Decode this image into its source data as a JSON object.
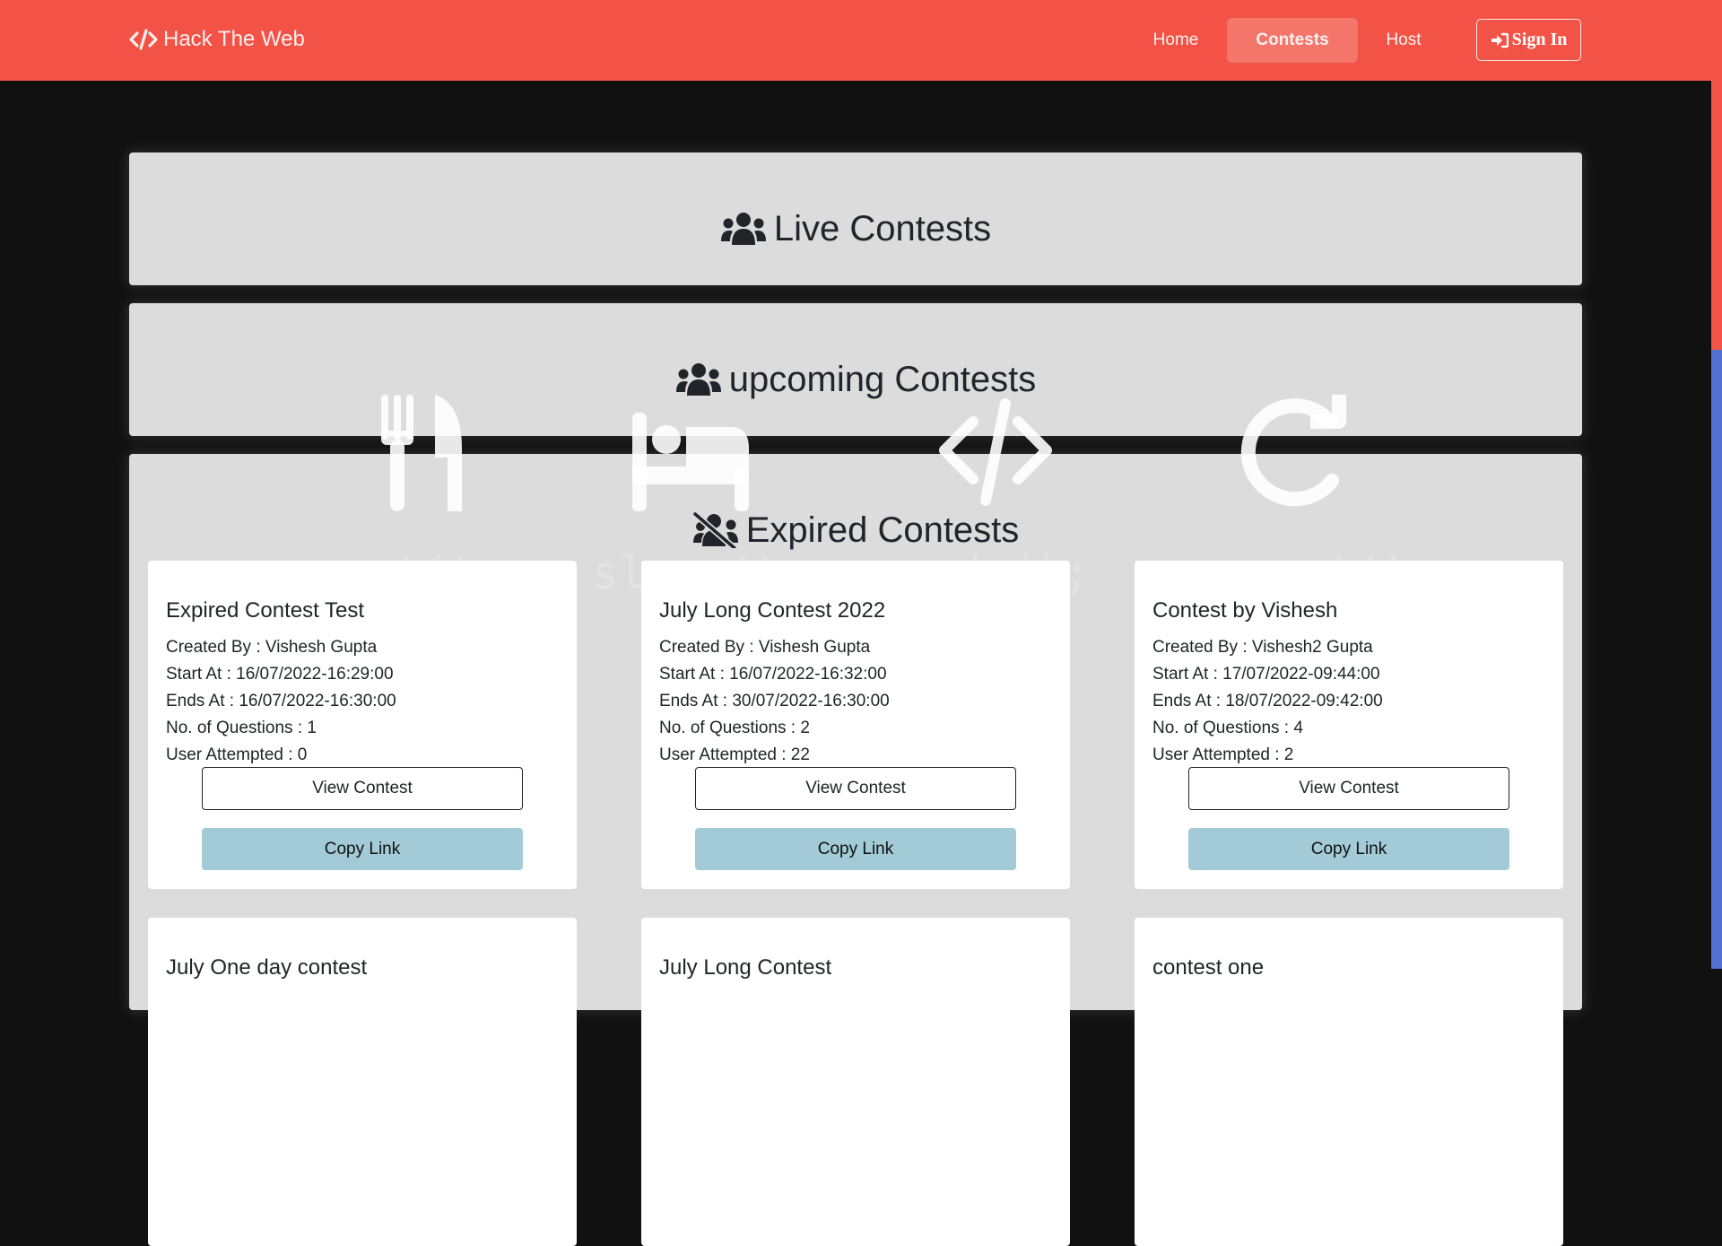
{
  "navbar": {
    "brand": "Hack The Web",
    "brand_icon": "code-icon",
    "links": [
      {
        "label": "Home",
        "active": false
      },
      {
        "label": "Contests",
        "active": true
      },
      {
        "label": "Host",
        "active": false
      }
    ],
    "signin_label": "Sign In",
    "signin_icon": "sign-in-icon",
    "colors": {
      "bar": "#f25346",
      "active_pill": "#f4766b"
    }
  },
  "sections": {
    "live": {
      "title": "Live Contests",
      "icon": "users-icon"
    },
    "upcoming": {
      "title": "upcoming Contests",
      "icon": "users-icon"
    },
    "expired": {
      "title": "Expired Contests",
      "icon": "users-slash-icon"
    }
  },
  "watermark": [
    {
      "icon": "utensils-icon",
      "text": "eat();"
    },
    {
      "icon": "bed-icon",
      "text": "sleep();"
    },
    {
      "icon": "code-icon",
      "text": "code();"
    },
    {
      "icon": "redo-icon",
      "text": "repeat();"
    }
  ],
  "contests": [
    {
      "title": "Expired Contest Test",
      "created_by": "Created By : Vishesh Gupta",
      "start_at": "Start At : 16/07/2022-16:29:00",
      "ends_at": "Ends At : 16/07/2022-16:30:00",
      "questions": "No. of Questions : 1",
      "attempted": "User Attempted : 0",
      "view_label": "View Contest",
      "copy_label": "Copy Link"
    },
    {
      "title": "July Long Contest 2022",
      "created_by": "Created By : Vishesh Gupta",
      "start_at": "Start At : 16/07/2022-16:32:00",
      "ends_at": "Ends At : 30/07/2022-16:30:00",
      "questions": "No. of Questions : 2",
      "attempted": "User Attempted : 22",
      "view_label": "View Contest",
      "copy_label": "Copy Link"
    },
    {
      "title": "Contest by Vishesh",
      "created_by": "Created By : Vishesh2 Gupta",
      "start_at": "Start At : 17/07/2022-09:44:00",
      "ends_at": "Ends At : 18/07/2022-09:42:00",
      "questions": "No. of Questions : 4",
      "attempted": "User Attempted : 2",
      "view_label": "View Contest",
      "copy_label": "Copy Link"
    },
    {
      "title": "July One day contest"
    },
    {
      "title": "July Long Contest"
    },
    {
      "title": "contest one"
    }
  ],
  "colors": {
    "page_bg": "#111111",
    "panel_bg": "#dcdcdc",
    "copy_button": "#a2cbd7",
    "scrollbar_thumb": "#5470d4"
  }
}
